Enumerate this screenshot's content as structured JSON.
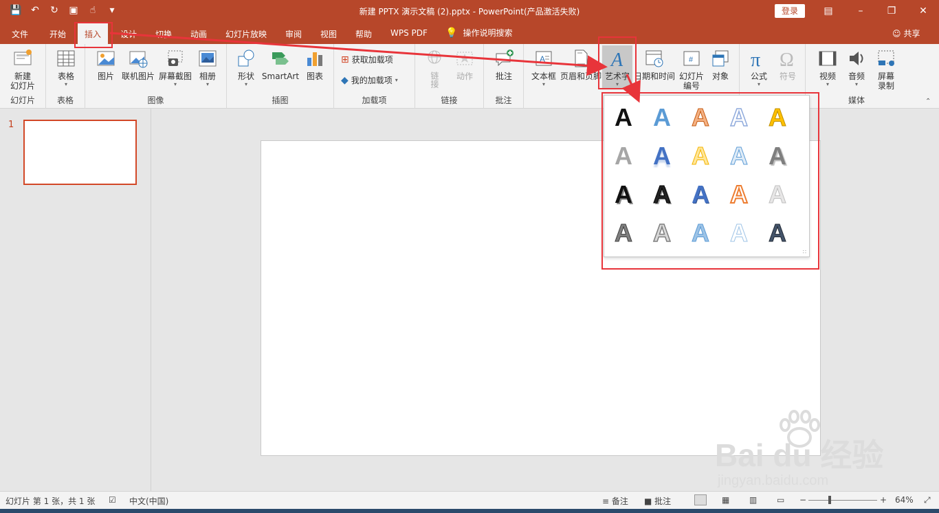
{
  "titlebar": {
    "title": "新建 PPTX 演示文稿 (2).pptx  -  PowerPoint(产品激活失败)",
    "login_label": "登录",
    "bg_color": "#b7472a"
  },
  "tabs": {
    "items": [
      "文件",
      "开始",
      "插入",
      "设计",
      "切换",
      "动画",
      "幻灯片放映",
      "审阅",
      "视图",
      "帮助",
      "WPS PDF"
    ],
    "active": "插入",
    "help_search": "操作说明搜索",
    "share": "共享"
  },
  "ribbon": {
    "groups": {
      "slides": "幻灯片",
      "tables": "表格",
      "images": "图像",
      "illustrations": "插图",
      "addins": "加载项",
      "links": "链接",
      "comments": "批注",
      "media": "媒体"
    },
    "buttons": {
      "new_slide": "新建\n幻灯片",
      "table": "表格",
      "picture": "图片",
      "online_picture": "联机图片",
      "screenshot": "屏幕截图",
      "album": "相册",
      "shapes": "形状",
      "smartart": "SmartArt",
      "chart": "图表",
      "get_addins": "获取加载项",
      "my_addins": "我的加载项",
      "link": "链接",
      "action": "动作",
      "comment": "批注",
      "textbox": "文本框",
      "header_footer": "页眉和页脚",
      "wordart": "艺术字",
      "datetime": "日期和时间",
      "slide_number": "幻灯片\n编号",
      "object": "对象",
      "equation": "公式",
      "symbol": "符号",
      "video": "视频",
      "audio": "音频",
      "screen_record": "屏幕\n录制"
    }
  },
  "thumbnails": {
    "number": "1"
  },
  "wordart_gallery": {
    "glyph": "A",
    "rows": [
      [
        "black-solid",
        "blue-gradient",
        "orange-outline",
        "blue-outline",
        "gold-gradient"
      ],
      [
        "gray-solid",
        "blue-reflect",
        "yellow-gradient",
        "lightblue-outline",
        "gray-shadow"
      ],
      [
        "black-bold",
        "dark-3d",
        "blue-bold",
        "orange-hollow",
        "silver-light"
      ],
      [
        "dark-pattern",
        "gray-pattern",
        "blue-pattern",
        "blue-thin-pattern",
        "navy-pattern"
      ]
    ]
  },
  "status": {
    "slide_info": "幻灯片 第 1 张，共 1 张",
    "language": "中文(中国)",
    "notes": "备注",
    "comments": "批注",
    "zoom": "64%"
  },
  "watermark": {
    "brand": "Bai du 经验",
    "url": "jingyan.baidu.com"
  }
}
